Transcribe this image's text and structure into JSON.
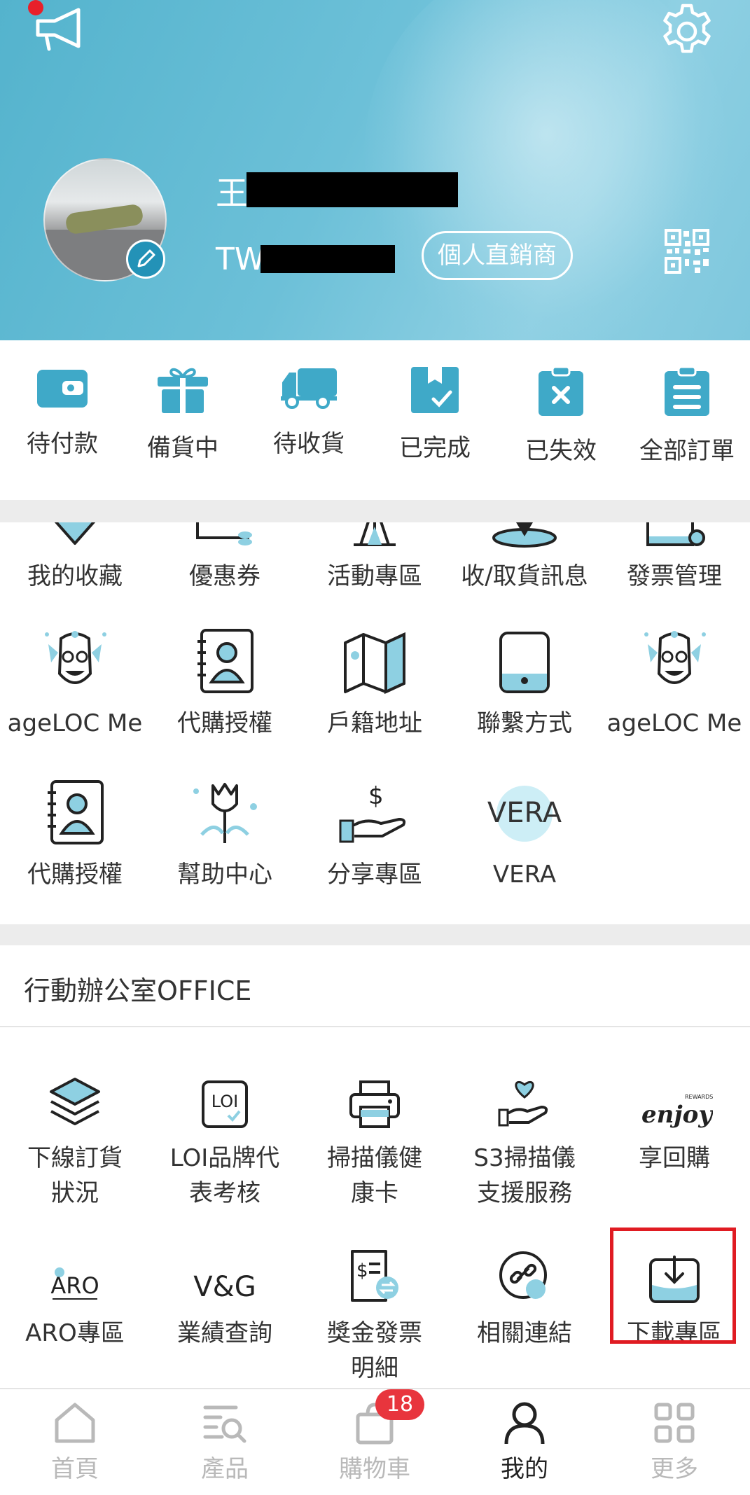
{
  "header": {
    "name_prefix": "王",
    "member_id_prefix": "TW",
    "role_badge": "個人直銷商"
  },
  "orders": [
    {
      "label": "待付款",
      "icon": "wallet-icon"
    },
    {
      "label": "備貨中",
      "icon": "gift-icon"
    },
    {
      "label": "待收貨",
      "icon": "truck-icon"
    },
    {
      "label": "已完成",
      "icon": "box-check-icon"
    },
    {
      "label": "已失效",
      "icon": "clipboard-x-icon"
    },
    {
      "label": "全部訂單",
      "icon": "clipboard-list-icon"
    }
  ],
  "services": [
    {
      "label": "我的收藏",
      "icon": "heart-icon"
    },
    {
      "label": "優惠券",
      "icon": "coupon-icon"
    },
    {
      "label": "活動專區",
      "icon": "event-icon"
    },
    {
      "label": "收/取貨訊息",
      "icon": "location-icon"
    },
    {
      "label": "發票管理",
      "icon": "invoice-icon"
    },
    {
      "label": "ageLOC Me",
      "icon": "ageloc-mascot-icon"
    },
    {
      "label": "代購授權",
      "icon": "contact-book-icon"
    },
    {
      "label": "戶籍地址",
      "icon": "map-icon"
    },
    {
      "label": "聯繫方式",
      "icon": "phone-icon"
    },
    {
      "label": "ageLOC Me",
      "icon": "ageloc-mascot-icon"
    },
    {
      "label": "代購授權",
      "icon": "contact-book-icon"
    },
    {
      "label": "幫助中心",
      "icon": "tulip-icon"
    },
    {
      "label": "分享專區",
      "icon": "hand-dollar-icon"
    },
    {
      "label": "VERA",
      "icon": "vera-logo-icon",
      "logo_text": "VERA"
    }
  ],
  "office": {
    "title": "行動辦公室OFFICE",
    "items": [
      {
        "label_line1": "下線訂貨",
        "label_line2": "狀況",
        "icon": "layers-icon"
      },
      {
        "label_line1": "LOI品牌代",
        "label_line2": "表考核",
        "icon": "loi-icon",
        "logo_text": "LOI"
      },
      {
        "label_line1": "掃描儀健",
        "label_line2": "康卡",
        "icon": "printer-icon"
      },
      {
        "label_line1": "S3掃描儀",
        "label_line2": "支援服務",
        "icon": "hand-heart-icon"
      },
      {
        "label_line1": "享回購",
        "label_line2": "",
        "icon": "enjoy-logo-icon",
        "logo_text": "enjoy",
        "logo_small": "REWARDS"
      },
      {
        "label_line1": "ARO專區",
        "label_line2": "",
        "icon": "aro-logo-icon",
        "logo_text": "ARO"
      },
      {
        "label_line1": "業績查詢",
        "label_line2": "",
        "icon": "vg-logo-icon",
        "logo_text": "V&G"
      },
      {
        "label_line1": "獎金發票",
        "label_line2": "明細",
        "icon": "bonus-invoice-icon"
      },
      {
        "label_line1": "相關連結",
        "label_line2": "",
        "icon": "link-icon"
      },
      {
        "label_line1": "下載專區",
        "label_line2": "",
        "icon": "download-icon"
      }
    ]
  },
  "nav": [
    {
      "label": "首頁",
      "icon": "home-icon"
    },
    {
      "label": "產品",
      "icon": "product-search-icon"
    },
    {
      "label": "購物車",
      "icon": "cart-bag-icon",
      "badge": "18"
    },
    {
      "label": "我的",
      "icon": "user-icon",
      "active": true
    },
    {
      "label": "更多",
      "icon": "grid-icon"
    }
  ],
  "colors": {
    "accent": "#3fa9c8",
    "accent_light": "#8ed0e2",
    "header": "#5fb8d2",
    "highlight": "#e01b22",
    "badge": "#e8353d"
  }
}
